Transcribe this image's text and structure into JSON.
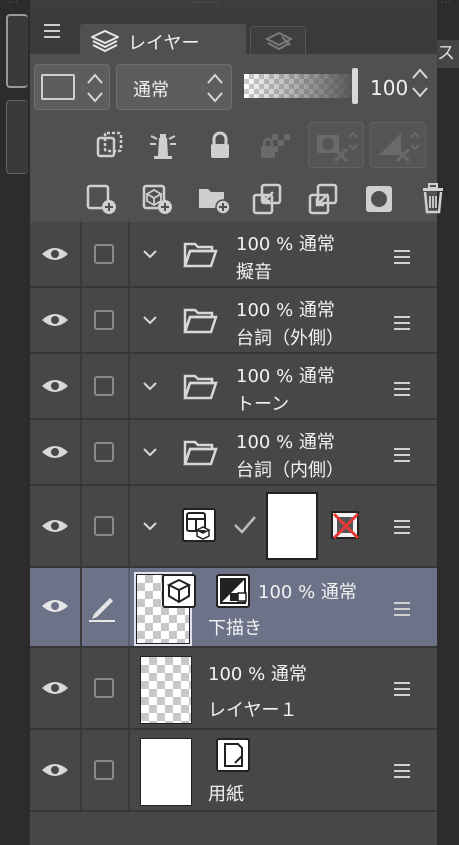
{
  "panel": {
    "tab_label": "レイヤー",
    "side_tab_text": "スト"
  },
  "toolbar": {
    "blend_mode": "通常",
    "opacity_value": "100",
    "opacity_fraction": 1.0
  },
  "icons": {
    "menu": "hamburger-menu-icon",
    "layers": "layers-icon",
    "layer_property": "layer-property-icon",
    "clip": "clip-to-layer-below-icon",
    "reference": "reference-layer-icon",
    "lock": "lock-icon",
    "lock_transparent": "lock-transparent-pixels-icon",
    "mask": "enable-mask-icon",
    "ruler": "ruler-display-icon",
    "new_raster": "new-raster-layer-icon",
    "new_vector": "new-vector-layer-icon",
    "new_folder": "new-folder-icon",
    "transfer_below": "transfer-to-lower-layer-icon",
    "combine_below": "combine-with-layer-below-icon",
    "create_mask": "create-layer-mask-icon",
    "delete": "delete-layer-icon"
  },
  "layers": [
    {
      "kind": "folder",
      "line1": "100 % 通常",
      "line2": "擬音"
    },
    {
      "kind": "folder",
      "line1": "100 % 通常",
      "line2": "台詞（外側）"
    },
    {
      "kind": "folder",
      "line1": "100 % 通常",
      "line2": "トーン"
    },
    {
      "kind": "folder",
      "line1": "100 % 通常",
      "line2": "台詞（内側）"
    },
    {
      "kind": "frame",
      "line1": "",
      "line2": ""
    },
    {
      "kind": "raster-selected",
      "line1": "100 % 通常",
      "line2": "下描き"
    },
    {
      "kind": "raster",
      "line1": "100 % 通常",
      "line2": "レイヤー１"
    },
    {
      "kind": "paper",
      "line1": "",
      "line2": "用紙"
    }
  ],
  "colors": {
    "selected_row": "#6c7288",
    "panel_bg": "#484848",
    "row_bg": "#474747"
  }
}
